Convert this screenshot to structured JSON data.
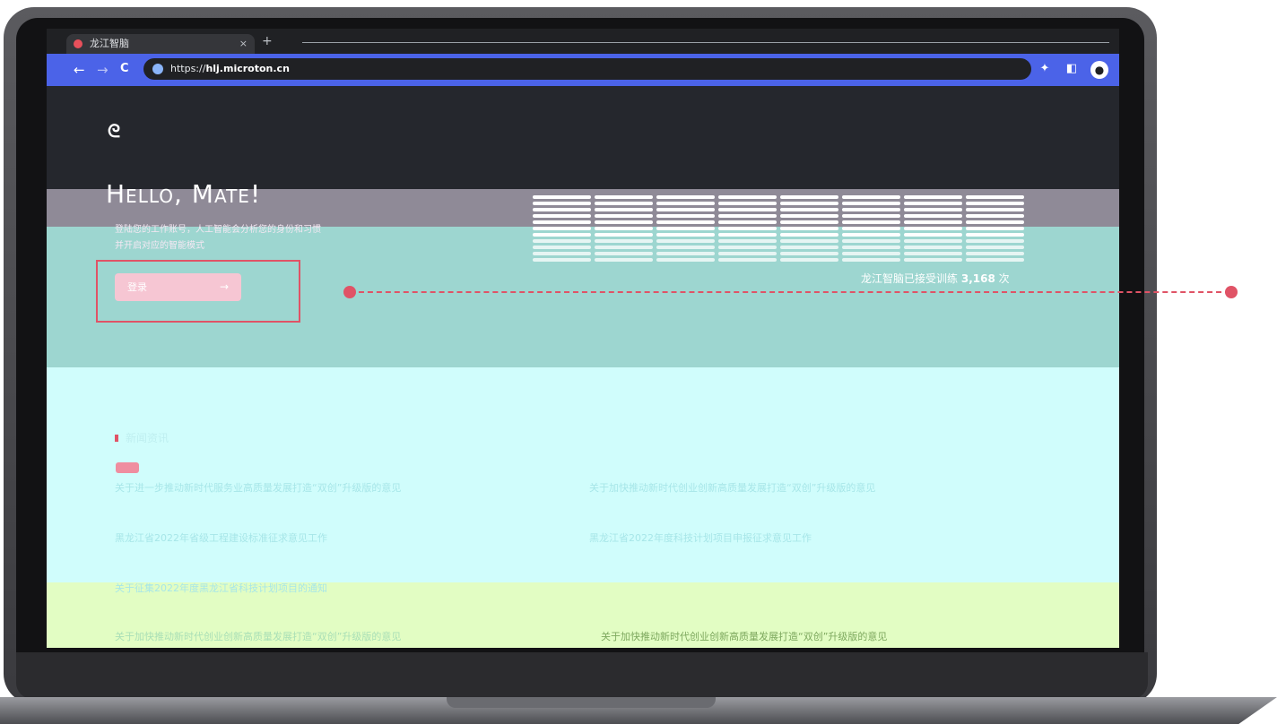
{
  "browser": {
    "tab": {
      "title": "龙江智脑",
      "close": "×"
    },
    "new_tab": "+",
    "nav": {
      "back": "←",
      "forward": "→",
      "reload": "C"
    },
    "url": {
      "scheme": "https://",
      "host": "hlj.microton.cn"
    },
    "toolbar_icons": [
      {
        "name": "extensions-icon",
        "glyph": "✦"
      },
      {
        "name": "sidebar-icon",
        "glyph": "◧"
      },
      {
        "name": "profile-icon",
        "glyph": "●"
      }
    ]
  },
  "hero": {
    "logo_glyph": "ᘓ",
    "greeting": "Hello, Mate!",
    "description_line1": "登陆您的工作账号，人工智能会分析您的身份和习惯",
    "description_line2": "并开启对应的智能模式",
    "login_button": "登录",
    "login_arrow": "→",
    "counter_text": "龙江智脑已接受训练",
    "counter_value": "3,168",
    "counter_unit": "次"
  },
  "news": {
    "heading": "新闻资讯",
    "items": [
      {
        "text": "关于进一步推动新时代服务业高质量发展打造“双创”升级版的意见"
      },
      {
        "text": "关于加快推动新时代创业创新高质量发展打造“双创”升级版的意见"
      },
      {
        "text": "黑龙江省2022年省级工程建设标准征求意见工作"
      },
      {
        "text": "黑龙江省2022年度科技计划项目申报征求意见工作"
      },
      {
        "text": "关于征集2022年度黑龙江省科技计划项目的通知"
      },
      {
        "text": "关于加快推动新时代创业创新高质量发展打造“双创”升级版的意见"
      },
      {
        "text": "关于加快推动新时代创业创新高质量发展打造“双创”升级版的意见"
      }
    ]
  },
  "colors": {
    "accent": "#e05366",
    "browser_toolbar": "#4b63e8",
    "hero_bg": "#25272d"
  }
}
